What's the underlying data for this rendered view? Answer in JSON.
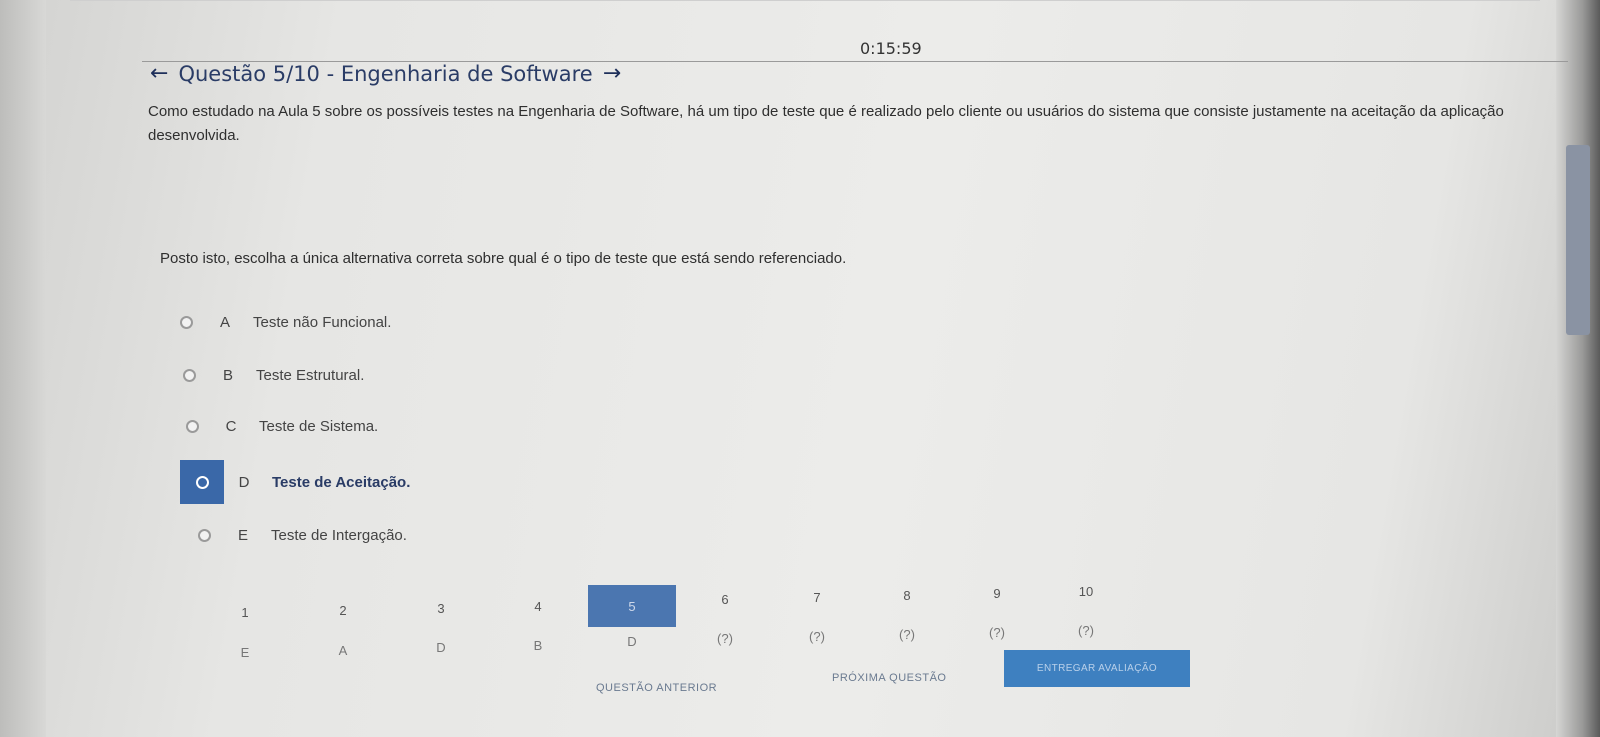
{
  "timer": "0:15:59",
  "header": {
    "title": "Questão 5/10 - Engenharia de Software"
  },
  "question": {
    "text": "Como estudado na Aula 5 sobre os possíveis testes na Engenharia de Software, há um tipo de teste que é realizado pelo cliente ou usuários do sistema que consiste justamente na aceitação da aplicação desenvolvida.",
    "prompt": "Posto isto, escolha a única alternativa correta sobre qual é o tipo de teste que está sendo referenciado."
  },
  "options": [
    {
      "letter": "A",
      "text": "Teste não Funcional.",
      "selected": false
    },
    {
      "letter": "B",
      "text": "Teste Estrutural.",
      "selected": false
    },
    {
      "letter": "C",
      "text": "Teste de Sistema.",
      "selected": false
    },
    {
      "letter": "D",
      "text": "Teste de Aceitação.",
      "selected": true
    },
    {
      "letter": "E",
      "text": "Teste de Intergação.",
      "selected": false
    }
  ],
  "navigator": {
    "numbers": [
      "1",
      "2",
      "3",
      "4",
      "5",
      "6",
      "7",
      "8",
      "9",
      "10"
    ],
    "answers": [
      "E",
      "A",
      "D",
      "B",
      "D",
      "(?)",
      "(?)",
      "(?)",
      "(?)",
      "(?)"
    ],
    "current": 5
  },
  "buttons": {
    "previous": "QUESTÃO ANTERIOR",
    "next": "PRÓXIMA QUESTÃO",
    "submit": "ENTREGAR AVALIAÇÃO"
  },
  "colors": {
    "accent": "#3a68a8",
    "submit": "#3e80c0",
    "header_text": "#2a3c66"
  }
}
